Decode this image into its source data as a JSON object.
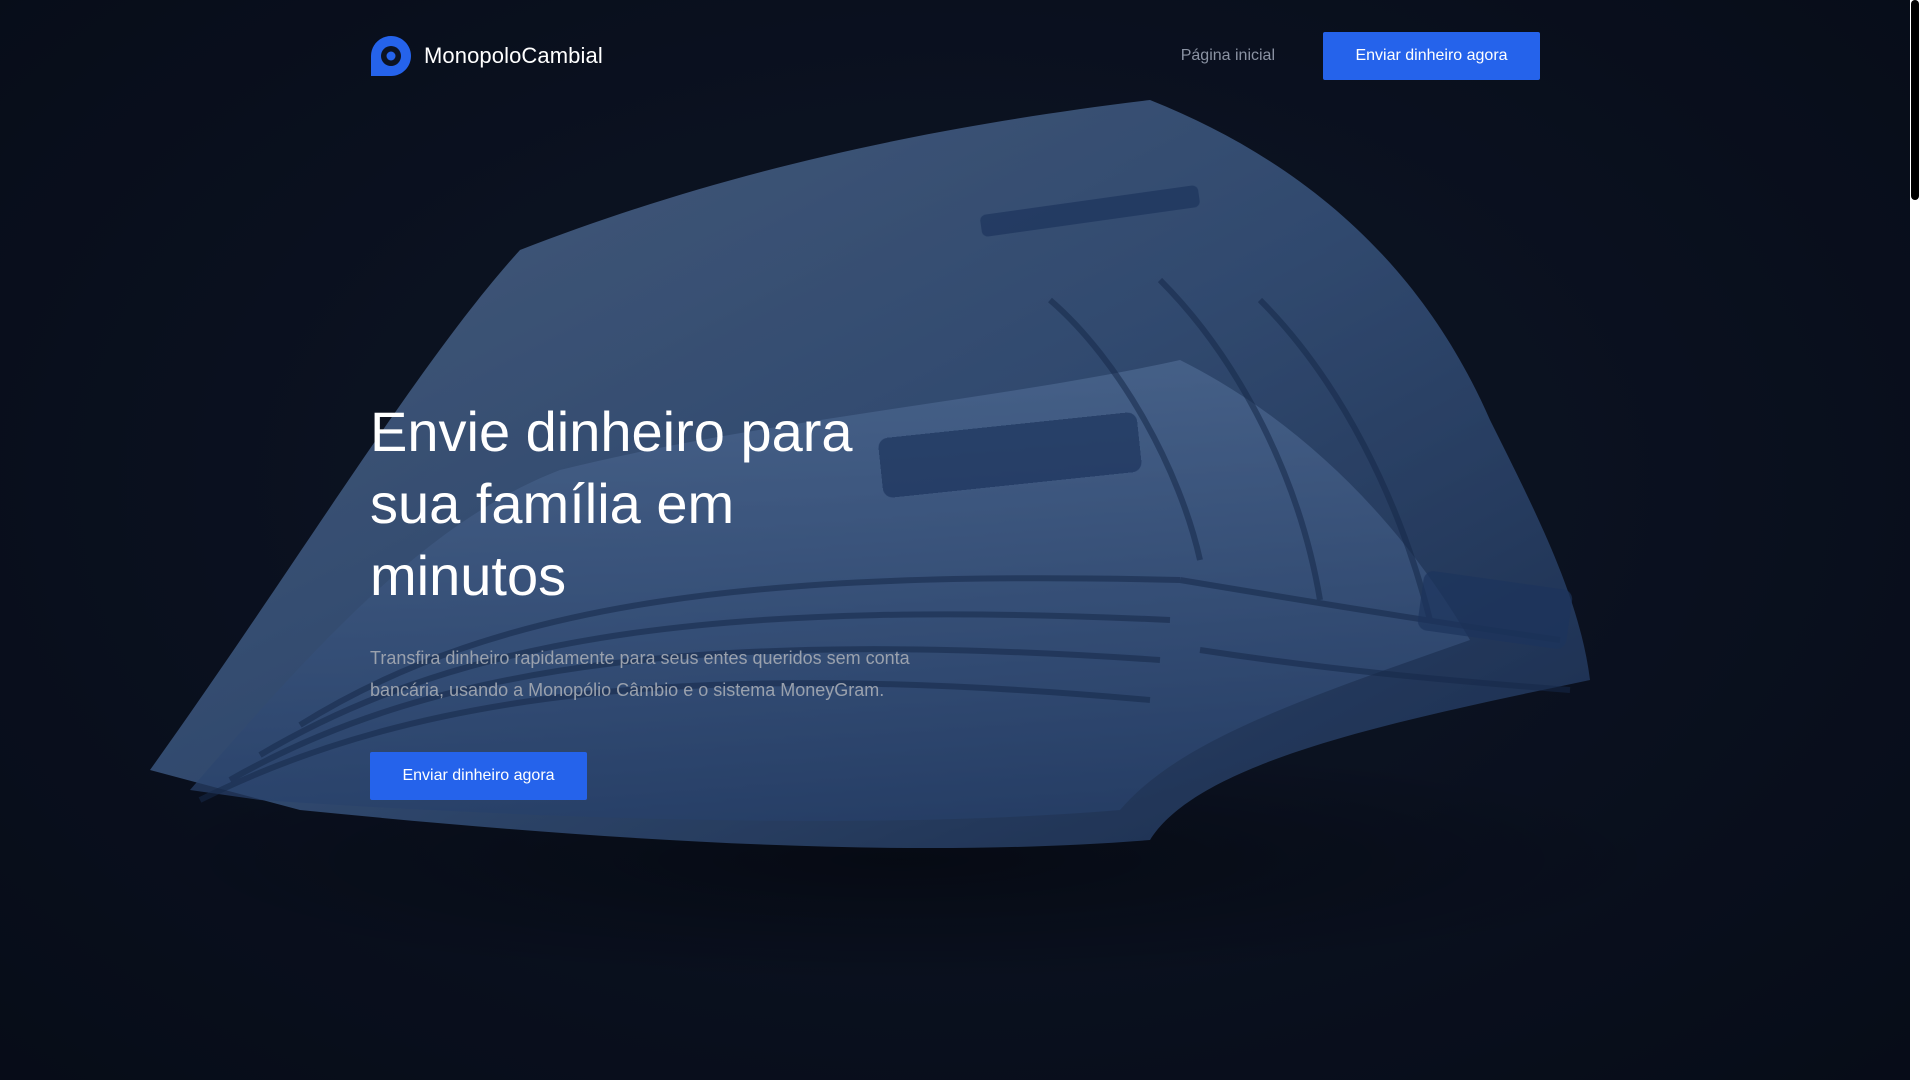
{
  "header": {
    "brand_name": "MonopoloCambial",
    "logo_icon": "brand-logo-icon",
    "nav_home_label": "Página inicial",
    "nav_cta_label": "Enviar dinheiro agora"
  },
  "hero": {
    "title": "Envie dinheiro para sua família em minutos",
    "subtitle": "Transfira dinheiro rapidamente para seus entes queridos sem conta bancária, usando a Monopólio Câmbio e o sistema MoneyGram.",
    "cta_label": "Enviar dinheiro agora",
    "background_image": "banknotes-photo"
  },
  "colors": {
    "accent": "#2563eb",
    "background": "#0b1120",
    "text_primary": "#ffffff",
    "text_muted": "#9aa1ad"
  }
}
